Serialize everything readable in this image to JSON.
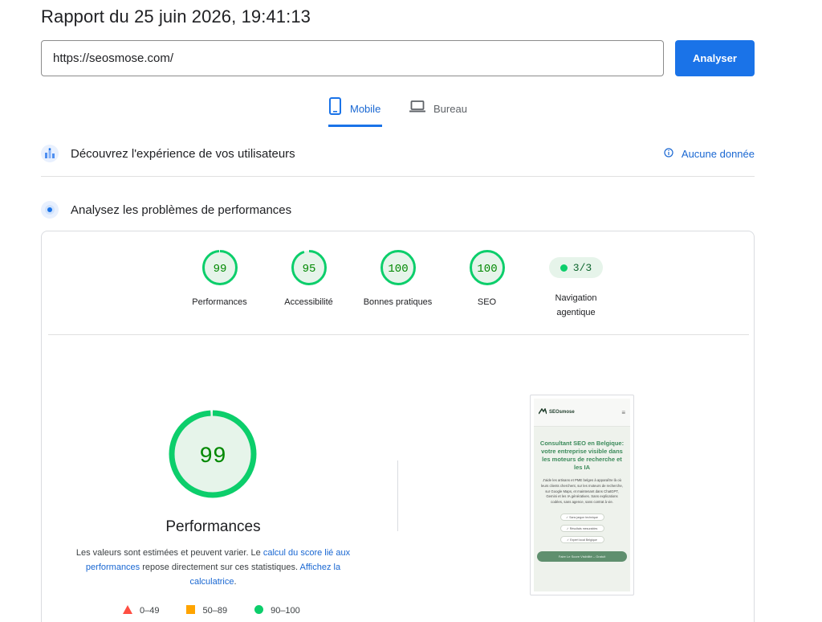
{
  "header": {
    "title": "Rapport du 25 juin 2026, 19:41:13"
  },
  "search": {
    "url_value": "https://seosmose.com/",
    "analyze_label": "Analyser"
  },
  "tabs": {
    "mobile": "Mobile",
    "desktop": "Bureau",
    "active": "Mobile"
  },
  "field_data": {
    "title": "Découvrez l'expérience de vos utilisateurs",
    "status": "Aucune donnée"
  },
  "lab_data": {
    "title": "Analysez les problèmes de performances"
  },
  "scores": [
    {
      "label": "Performances",
      "value": 99
    },
    {
      "label": "Accessibilité",
      "value": 95
    },
    {
      "label": "Bonnes pratiques",
      "value": 100
    },
    {
      "label": "SEO",
      "value": 100
    }
  ],
  "agentic": {
    "value": "3/3",
    "label_line1": "Navigation",
    "label_line2": "agentique"
  },
  "main_score": {
    "value": 99,
    "title": "Performances",
    "disclaimer_text1": "Les valeurs sont estimées et peuvent varier. Le ",
    "disclaimer_link1": "calcul du score lié aux performances",
    "disclaimer_text2": " repose directement sur ces statistiques. ",
    "disclaimer_link2": "Affichez la calculatrice",
    "disclaimer_text3": "."
  },
  "legend": {
    "fail": "0–49",
    "average": "50–89",
    "pass": "90–100"
  },
  "preview": {
    "brand": "SEOsmose",
    "headline": "Consultant SEO en Belgique: votre entreprise visible dans les moteurs de recherche et les IA",
    "body": "J'aide les artisans et PME belges à apparaître là où leurs clients cherchent, sur les moteurs de recherche, sur Google Maps, et maintenant dans ChatGPT, Gemini et les IA génératives. Sans explications codées, sans agence, sans contrat à vie.",
    "chips": [
      "✓ Sans jargon technique",
      "✓ Résultats mesurables",
      "✓ Expert local Belgique"
    ],
    "cta": "Faire Le Score Visibilité – Gratuit"
  },
  "colors": {
    "accent": "#1a73e8",
    "pass": "#0cce6b",
    "pass_text": "#008800",
    "pass_fill": "#e6f4ea",
    "average": "#ffa400",
    "fail": "#ff4e42"
  }
}
